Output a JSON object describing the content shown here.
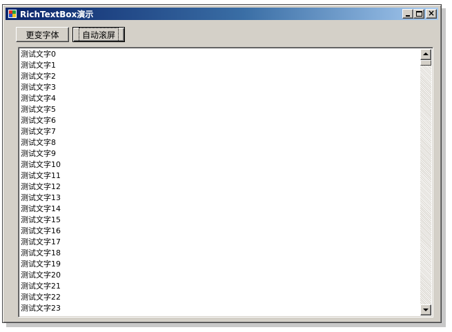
{
  "window": {
    "title": "RichTextBox演示"
  },
  "toolbar": {
    "change_font_label": "更变字体",
    "auto_scroll_label": "自动滚屏"
  },
  "richtextbox": {
    "lines": [
      "测试文字0",
      "测试文字1",
      "测试文字2",
      "测试文字3",
      "测试文字4",
      "测试文字5",
      "测试文字6",
      "测试文字7",
      "测试文字8",
      "测试文字9",
      "测试文字10",
      "测试文字11",
      "测试文字12",
      "测试文字13",
      "测试文字14",
      "测试文字15",
      "测试文字16",
      "测试文字17",
      "测试文字18",
      "测试文字19",
      "测试文字20",
      "测试文字21",
      "测试文字22",
      "测试文字23"
    ]
  },
  "colors": {
    "title_gradient_start": "#0a246a",
    "title_gradient_end": "#a6caf0",
    "window_face": "#d4d0c8"
  },
  "icons": [
    "app-icon",
    "minimize-icon",
    "maximize-icon",
    "close-icon",
    "scroll-up-icon",
    "scroll-down-icon"
  ]
}
